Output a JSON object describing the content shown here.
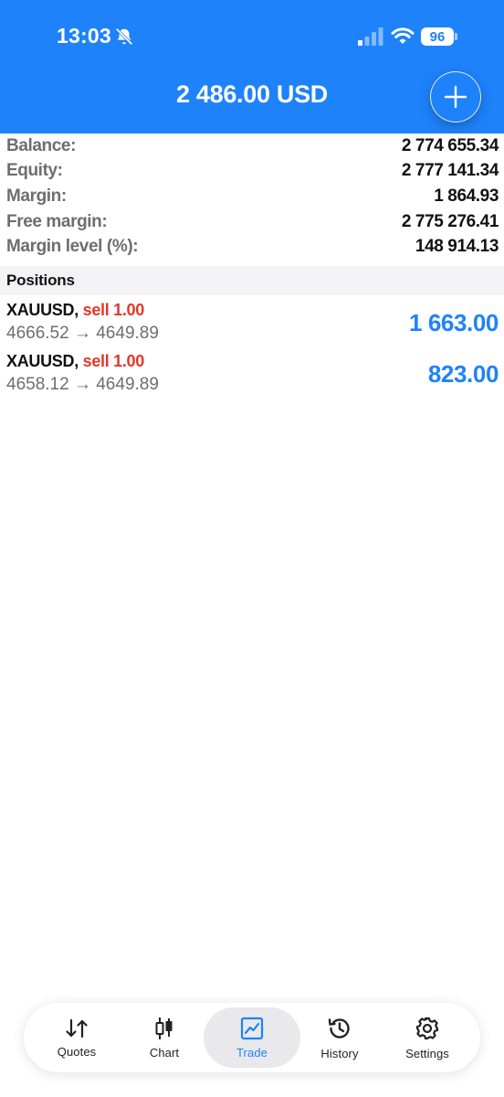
{
  "status_bar": {
    "time": "13:03",
    "battery": "96"
  },
  "header": {
    "title": "2 486.00 USD"
  },
  "summary": [
    {
      "label": "Balance:",
      "value": "2 774 655.34"
    },
    {
      "label": "Equity:",
      "value": "2 777 141.34"
    },
    {
      "label": "Margin:",
      "value": "1 864.93"
    },
    {
      "label": "Free margin:",
      "value": "2 775 276.41"
    },
    {
      "label": "Margin level (%):",
      "value": "148 914.13"
    }
  ],
  "positions_header": "Positions",
  "positions": [
    {
      "symbol": "XAUUSD,",
      "side": "sell 1.00",
      "prices": "4666.52 → 4649.89",
      "profit": "1 663.00"
    },
    {
      "symbol": "XAUUSD,",
      "side": "sell 1.00",
      "prices": "4658.12 → 4649.89",
      "profit": "823.00"
    }
  ],
  "tabs": [
    {
      "label": "Quotes",
      "icon": "quotes-arrows-icon"
    },
    {
      "label": "Chart",
      "icon": "candlestick-icon"
    },
    {
      "label": "Trade",
      "icon": "trade-chart-icon",
      "active": true
    },
    {
      "label": "History",
      "icon": "history-clock-icon"
    },
    {
      "label": "Settings",
      "icon": "gear-icon"
    }
  ],
  "colors": {
    "header_bg": "#1e82fa",
    "sell": "#e5372b",
    "profit": "#1e82fa",
    "active_tab": "#1e82fa"
  }
}
